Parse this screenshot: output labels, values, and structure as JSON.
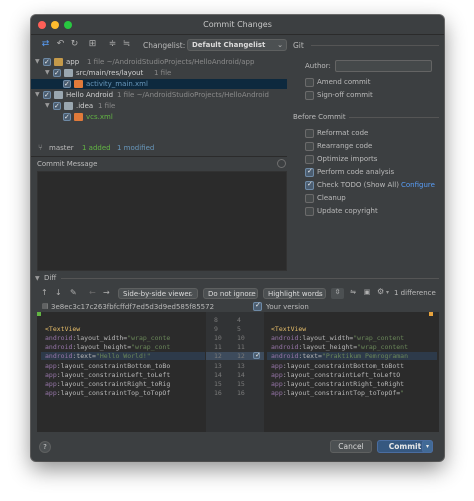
{
  "window": {
    "title": "Commit Changes"
  },
  "toolbar": {
    "changelist_label": "Changelist:",
    "changelist_value": "Default Changelist",
    "git_label": "Git"
  },
  "tree": {
    "rows": [
      {
        "name": "app",
        "meta": "1 file  ~/AndroidStudioProjects/HelloAndroid/app"
      },
      {
        "name": "src/main/res/layout",
        "meta": "1 file"
      },
      {
        "name": "activity_main.xml",
        "meta": ""
      },
      {
        "name": "Hello Android",
        "meta": "1 file  ~/AndroidStudioProjects/HelloAndroid"
      },
      {
        "name": ".idea",
        "meta": "1 file"
      },
      {
        "name": "vcs.xml",
        "meta": ""
      }
    ]
  },
  "status": {
    "branch": "master",
    "added": "1 added",
    "modified": "1 modified"
  },
  "commit_message": {
    "label": "Commit Message",
    "value": ""
  },
  "git_panel": {
    "author_label": "Author:",
    "author_value": "",
    "amend": "Amend commit",
    "signoff": "Sign-off commit",
    "before_commit": "Before Commit",
    "options": [
      {
        "label": "Reformat code",
        "checked": false
      },
      {
        "label": "Rearrange code",
        "checked": false
      },
      {
        "label": "Optimize imports",
        "checked": false
      },
      {
        "label": "Perform code analysis",
        "checked": true
      },
      {
        "label": "Check TODO (Show All)",
        "checked": true
      },
      {
        "label": "Cleanup",
        "checked": false
      },
      {
        "label": "Update copyright",
        "checked": false
      }
    ],
    "configure_link": "Configure"
  },
  "diff": {
    "label": "Diff",
    "viewer": "Side-by-side viewer",
    "ignore": "Do not ignore",
    "highlight": "Highlight words",
    "count": "1 difference",
    "left_hash": "3e8ec3c17c263fbfcffdf7ed5d3d9ed585f85572",
    "right_label": "Your version",
    "left_lines": [
      "",
      "<TextView",
      "    android:layout_width=\"wrap_conte",
      "    android:layout_height=\"wrap_cont",
      "    android:text=\"Hello World!\"",
      "    app:layout_constraintBottom_toBo",
      "    app:layout_constraintLeft_toLeft",
      "    app:layout_constraintRight_toRig",
      "    app:layout_constraintTop_toTopOf"
    ],
    "right_lines": [
      "",
      "<TextView",
      "    android:layout_width=\"wrap_content",
      "    android:layout_height=\"wrap_content",
      "    android:text=\"Praktikum Pemrograman",
      "    app:layout_constraintBottom_toBott",
      "    app:layout_constraintLeft_toLeftO",
      "    app:layout_constraintRight_toRight",
      "    app:layout_constraintTop_toTopOf=\""
    ],
    "gutter_left": [
      "8",
      "9",
      "10",
      "11",
      "12",
      "13",
      "14",
      "15",
      "16"
    ],
    "gutter_right": [
      "4",
      "5",
      "10",
      "11",
      "12",
      "13",
      "14",
      "15",
      "16"
    ]
  },
  "buttons": {
    "help": "?",
    "cancel": "Cancel",
    "commit": "Commit"
  },
  "colors": {
    "background": "#3c3f41",
    "editor": "#2b2b2b",
    "selection": "#0d293e",
    "accent": "#365880",
    "link": "#589df6",
    "added": "#62b543",
    "modified": "#6897bb",
    "tag": "#e8bf6a",
    "attr": "#9876aa",
    "string": "#6a8759",
    "changed_line": "#2d3a4a"
  }
}
